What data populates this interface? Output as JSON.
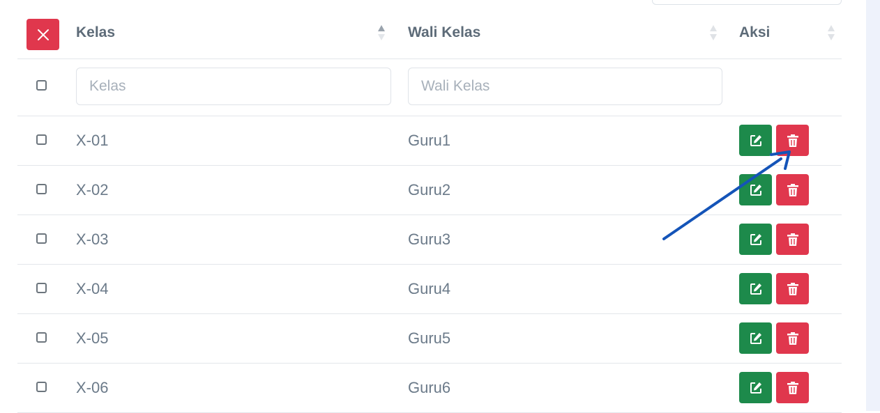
{
  "colors": {
    "danger": "#e0374d",
    "success": "#1d8a4b",
    "annotation_arrow": "#1454b8",
    "background_strip": "#eef2fb"
  },
  "table": {
    "columns": [
      {
        "label": "Kelas",
        "sort": "ascending"
      },
      {
        "label": "Wali Kelas",
        "sort": "none"
      },
      {
        "label": "Aksi",
        "sort": "none"
      }
    ],
    "clear_button_icon": "close-icon",
    "filters": {
      "kelas_placeholder": "Kelas",
      "wali_kelas_placeholder": "Wali Kelas"
    },
    "rows": [
      {
        "kelas": "X-01",
        "wali_kelas": "Guru1"
      },
      {
        "kelas": "X-02",
        "wali_kelas": "Guru2"
      },
      {
        "kelas": "X-03",
        "wali_kelas": "Guru3"
      },
      {
        "kelas": "X-04",
        "wali_kelas": "Guru4"
      },
      {
        "kelas": "X-05",
        "wali_kelas": "Guru5"
      },
      {
        "kelas": "X-06",
        "wali_kelas": "Guru6"
      }
    ],
    "row_actions": [
      {
        "icon": "edit-icon",
        "variant": "success"
      },
      {
        "icon": "trash-icon",
        "variant": "danger"
      }
    ]
  },
  "annotation": {
    "type": "arrow",
    "points_to": "delete-button row X-01"
  }
}
